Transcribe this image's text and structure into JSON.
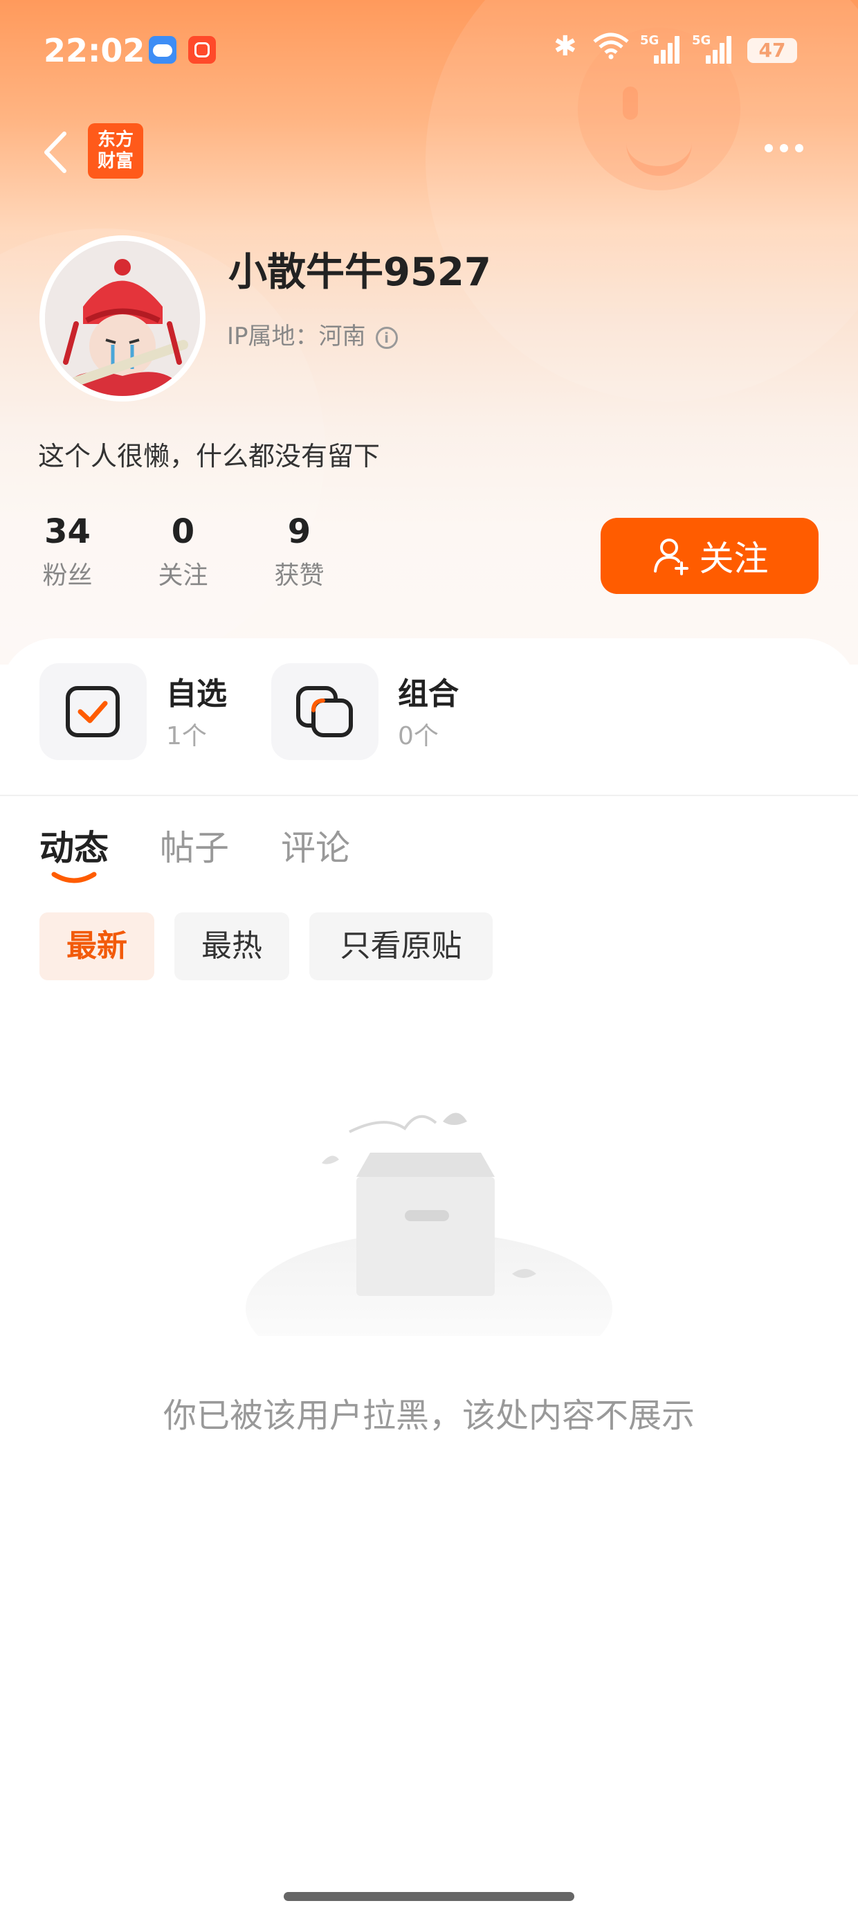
{
  "status_bar": {
    "time": "22:02",
    "network_1": "5G",
    "network_2": "5G",
    "battery": "47"
  },
  "nav": {
    "brand_line1": "东方",
    "brand_line2": "财富"
  },
  "profile": {
    "username": "小散牛牛9527",
    "ip_location": "IP属地：河南",
    "bio": "这个人很懒，什么都没有留下"
  },
  "stats": [
    {
      "value": "34",
      "label": "粉丝"
    },
    {
      "value": "0",
      "label": "关注"
    },
    {
      "value": "9",
      "label": "获赞"
    }
  ],
  "follow_label": "关注",
  "features": [
    {
      "title": "自选",
      "count": "1个"
    },
    {
      "title": "组合",
      "count": "0个"
    }
  ],
  "tabs": [
    "动态",
    "帖子",
    "评论"
  ],
  "filters": [
    "最新",
    "最热",
    "只看原贴"
  ],
  "empty_message": "你已被该用户拉黑，该处内容不展示",
  "colors": {
    "accent": "#ff5c00",
    "header_top": "#ff9a5c"
  }
}
